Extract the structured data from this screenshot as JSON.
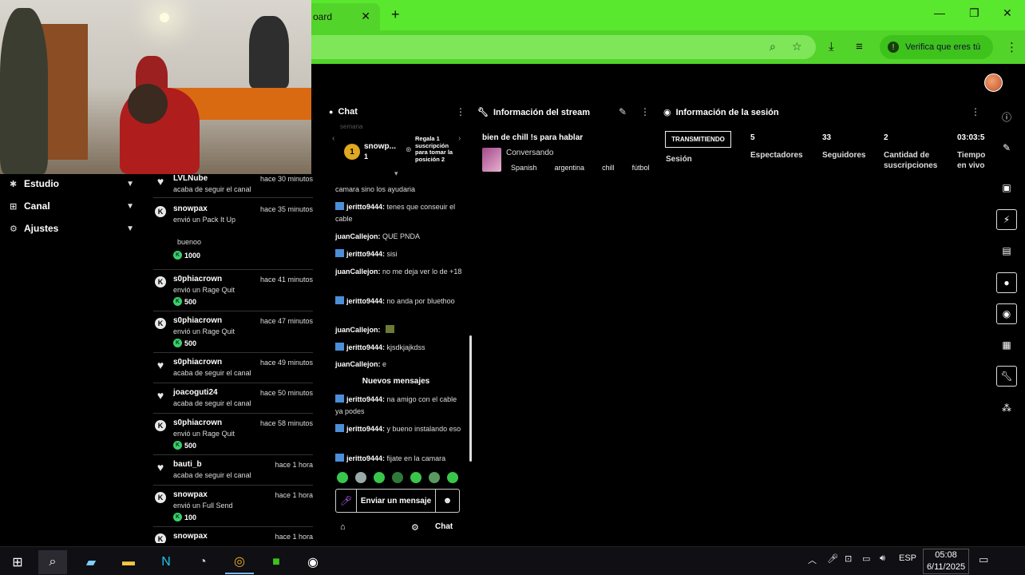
{
  "browser": {
    "tab_title": "oard",
    "new_tab": "+",
    "close_tab": "✕",
    "verify_label": "Verifica que eres tú"
  },
  "nav": {
    "items": [
      {
        "label": "Estudio",
        "icon": "studio-icon"
      },
      {
        "label": "Canal",
        "icon": "channel-icon"
      },
      {
        "label": "Ajustes",
        "icon": "settings-icon"
      }
    ]
  },
  "activity": [
    {
      "user": "LVLNube",
      "time": "hace 30 minutos",
      "desc": "acaba de seguir el canal",
      "type": "follow"
    },
    {
      "user": "snowpax",
      "time": "hace 35 minutos",
      "desc": "envió un Pack It Up",
      "type": "gift",
      "message": "buenoo",
      "amount": "1000"
    },
    {
      "user": "s0phiacrown",
      "time": "hace 41 minutos",
      "desc": "envió un Rage Quit",
      "type": "gift",
      "amount": "500"
    },
    {
      "user": "s0phiacrown",
      "time": "hace 47 minutos",
      "desc": "envió un Rage Quit",
      "type": "gift",
      "amount": "500"
    },
    {
      "user": "s0phiacrown",
      "time": "hace 49 minutos",
      "desc": "acaba de seguir el canal",
      "type": "follow"
    },
    {
      "user": "joacoguti24",
      "time": "hace 50 minutos",
      "desc": "acaba de seguir el canal",
      "type": "follow"
    },
    {
      "user": "s0phiacrown",
      "time": "hace 58 minutos",
      "desc": "envió un Rage Quit",
      "type": "gift",
      "amount": "500"
    },
    {
      "user": "bauti_b",
      "time": "hace 1 hora",
      "desc": "acaba de seguir el canal",
      "type": "follow"
    },
    {
      "user": "snowpax",
      "time": "hace 1 hora",
      "desc": "envió un Full Send",
      "type": "gift",
      "amount": "100"
    },
    {
      "user": "snowpax",
      "time": "hace 1 hora",
      "desc": "",
      "type": "gift"
    }
  ],
  "chat": {
    "title": "Chat",
    "week_label": "semana",
    "pinned": {
      "rank": "1",
      "user": "snowp...",
      "count": "1",
      "cta": "Regala 1 suscripción para tomar la posición 2"
    },
    "partial_top": "camara sino los ayudaria",
    "messages": [
      {
        "user": "jeritto9444:",
        "text": "tenes que conseuir el cable",
        "badge": true
      },
      {
        "user": "juanCallejon:",
        "text": "QUE PNDA",
        "badge": false
      },
      {
        "user": "jeritto9444:",
        "text": "sisi",
        "badge": true
      },
      {
        "user": "juanCallejon:",
        "text": "no me deja ver lo de +18",
        "badge": false
      },
      {
        "user": "jeritto9444:",
        "text": "no anda por bluethoo",
        "badge": true
      },
      {
        "user": "juanCallejon:",
        "text": "",
        "badge": false
      },
      {
        "user": "jeritto9444:",
        "text": "kjsdkjajkdss",
        "badge": true
      },
      {
        "user": "juanCallejon:",
        "text": "e",
        "badge": false
      }
    ],
    "new_messages_label": "Nuevos mensajes",
    "new_messages": [
      {
        "user": "jeritto9444:",
        "text": "na amigo con el cable ya podes",
        "badge": true
      },
      {
        "user": "jeritto9444:",
        "text": "y bueno instalando eso",
        "badge": true
      },
      {
        "user": "jeritto9444:",
        "text": "fijate en la camara",
        "badge": true
      }
    ],
    "send_placeholder": "Enviar un mensaje",
    "footer_label": "Chat"
  },
  "stream_info": {
    "title": "Información del stream",
    "stream_title": "bien de chill !s para hablar",
    "category": "Conversando",
    "tags": [
      "Spanish",
      "argentina",
      "chill",
      "fútbol"
    ]
  },
  "session": {
    "title": "Información de la sesión",
    "status": "TRANSMITIENDO",
    "session_label": "Sesión",
    "stats": [
      {
        "value": "5",
        "label": "Espectadores"
      },
      {
        "value": "33",
        "label": "Seguidores"
      },
      {
        "value": "2",
        "label": "Cantidad de suscripciones"
      },
      {
        "value": "03:03:5",
        "label": "Tiempo en vivo"
      }
    ]
  },
  "taskbar": {
    "lang": "ESP",
    "time": "05:08",
    "date": "6/11/2025"
  },
  "colors": {
    "chrome_green": "#5ae82e",
    "accent_green": "#38c74a",
    "badge_blue": "#4a8fd8"
  }
}
